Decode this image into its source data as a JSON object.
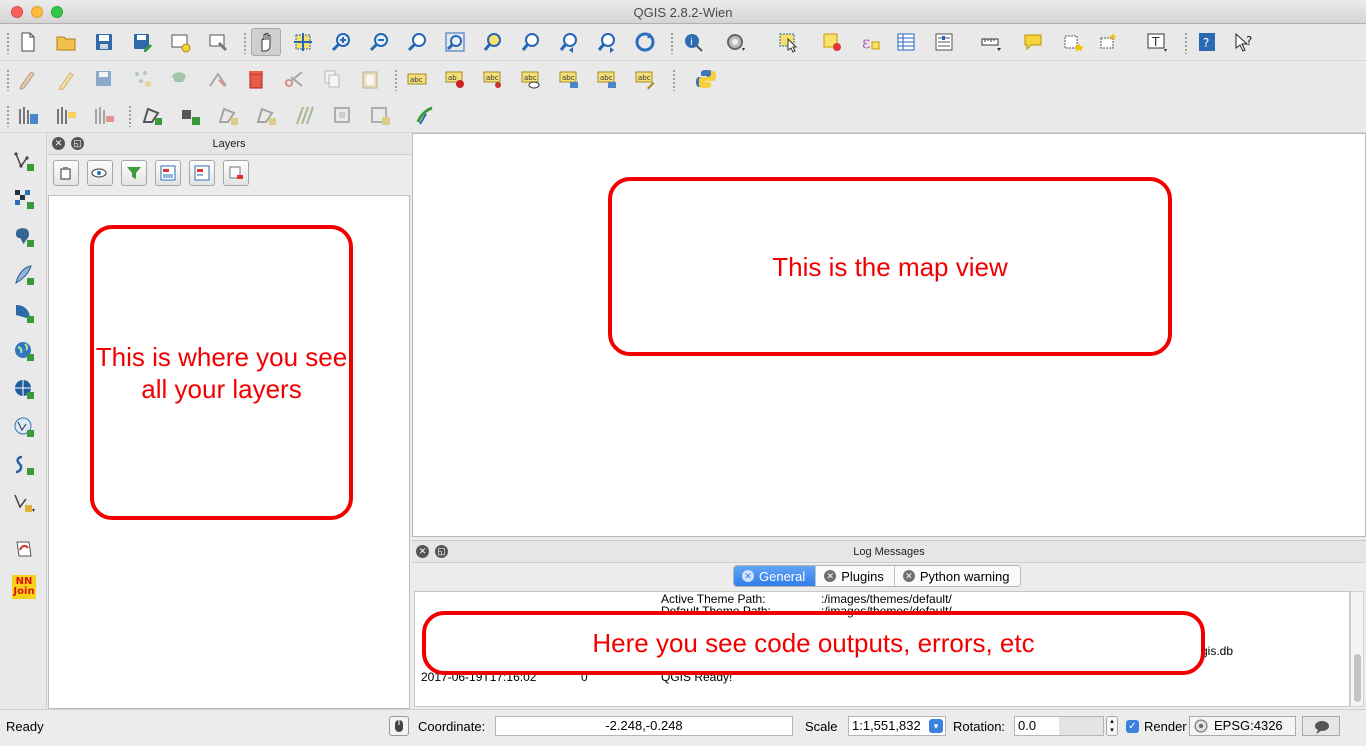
{
  "window": {
    "title": "QGIS 2.8.2-Wien"
  },
  "layers_panel": {
    "title": "Layers"
  },
  "log_panel": {
    "title": "Log Messages",
    "tabs": [
      {
        "label": "General",
        "active": true
      },
      {
        "label": "Plugins",
        "active": false
      },
      {
        "label": "Python warning",
        "active": false
      }
    ],
    "lines": [
      {
        "label": "Active Theme Path:",
        "value": ":/images/themes/default/"
      },
      {
        "label": "Default Theme Path:",
        "value": ":/images/themes/default/"
      },
      {
        "tail": "gis.db"
      },
      {
        "timestamp": "2017-06-19T17:16:02",
        "level": "0",
        "message": "QGIS Ready!"
      }
    ]
  },
  "annotations": {
    "layers": "This is where you see all your layers",
    "map": "This is the map view",
    "log": "Here you see code outputs, errors, etc"
  },
  "status_bar": {
    "message": "Ready",
    "coordinate_label": "Coordinate:",
    "coordinate_value": "-2.248,-0.248",
    "scale_label": "Scale",
    "scale_value": "1:1,551,832",
    "rotation_label": "Rotation:",
    "rotation_value": "0.0",
    "render_label": "Render",
    "render_checked": true,
    "crs_label": "EPSG:4326"
  },
  "icons": {
    "toolbar1": [
      "new-project-icon",
      "open-project-icon",
      "save-project-icon",
      "save-as-icon",
      "new-print-composer-icon",
      "composer-manager-icon",
      "pan-icon",
      "pan-to-selection-icon",
      "zoom-in-icon",
      "zoom-out-icon",
      "zoom-native-icon",
      "zoom-full-icon",
      "zoom-to-selection-icon",
      "zoom-to-layer-icon",
      "zoom-last-icon",
      "zoom-next-icon",
      "refresh-icon",
      "identify-icon",
      "run-feature-action-icon",
      "select-features-icon",
      "deselect-icon",
      "expression-select-icon",
      "attribute-table-icon",
      "statistics-icon",
      "measure-icon",
      "map-tips-icon",
      "new-bookmark-icon",
      "show-bookmarks-icon",
      "text-annotation-icon",
      "help-icon",
      "whats-this-icon"
    ],
    "toolbar2": [
      "current-edits-icon",
      "toggle-editing-icon",
      "save-edits-icon",
      "add-feature-icon",
      "move-feature-icon",
      "node-tool-icon",
      "delete-selected-icon",
      "cut-features-icon",
      "copy-features-icon",
      "paste-features-icon",
      "label-icon",
      "pin-labels-icon",
      "highlight-pinned-labels-icon",
      "show-hide-labels-icon",
      "move-label-icon",
      "rotate-label-icon",
      "change-label-icon",
      "python-console-icon"
    ],
    "toolbar3": [
      "digitize-1-icon",
      "digitize-2-icon",
      "digitize-3-icon",
      "add-ring-icon",
      "add-part-icon",
      "fill-ring-icon",
      "delete-ring-icon",
      "reshape-icon",
      "offset-curve-icon",
      "split-features-icon",
      "merge-features-icon",
      "geometry-checker-icon"
    ],
    "left_toolbar": [
      "add-vector-layer-icon",
      "add-raster-layer-icon",
      "add-postgis-layer-icon",
      "add-spatialite-layer-icon",
      "add-mssql-layer-icon",
      "add-wms-layer-icon",
      "add-wcs-layer-icon",
      "add-wfs-layer-icon",
      "add-delimited-text-layer-icon",
      "new-shapefile-layer-icon",
      "gps-tools-icon",
      "nnjoin-icon"
    ],
    "layers_tools": [
      "add-group-icon",
      "manage-visibility-icon",
      "filter-legend-icon",
      "expand-all-icon",
      "collapse-all-icon",
      "remove-layer-icon"
    ]
  },
  "nnjoin_text": "NN\nJoin"
}
